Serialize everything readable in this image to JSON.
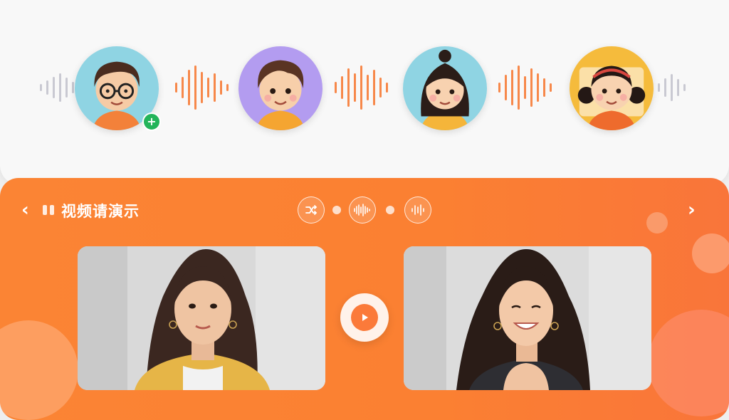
{
  "colors": {
    "accent": "#fb7f33",
    "wave_active": "#f7884a",
    "wave_inactive": "#c9c9d2",
    "badge": "#23b45a"
  },
  "speakers": [
    {
      "icon": "boy-with-glasses-avatar-icon",
      "bg": "#8fd4e3",
      "badge": "+"
    },
    {
      "icon": "boy-avatar-icon",
      "bg": "#b39cf0"
    },
    {
      "icon": "girl-ponytail-avatar-icon",
      "bg": "#8fd4e3"
    },
    {
      "icon": "girl-with-headband-avatar-icon",
      "bg": "#f5bb3c"
    }
  ],
  "demo": {
    "back_icon": "chevron-left-icon",
    "pause_icon": "pause-icon",
    "title": "视频请演示",
    "controls": [
      "shuffle-icon",
      "waveform-icon",
      "waveform-icon"
    ],
    "next_icon": "chevron-right-icon",
    "play_icon": "play-icon",
    "videos": [
      {
        "icon": "woman-portrait-neutral-icon"
      },
      {
        "icon": "woman-portrait-smiling-icon"
      }
    ]
  }
}
